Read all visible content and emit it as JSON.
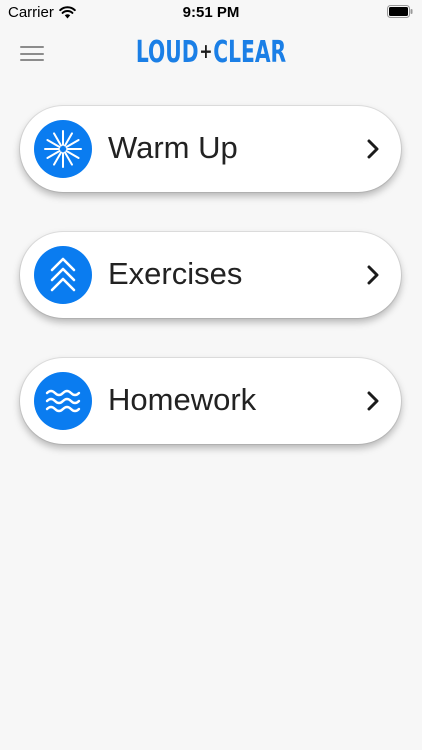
{
  "status_bar": {
    "carrier": "Carrier",
    "time": "9:51 PM"
  },
  "header": {
    "logo_left": "LOUD",
    "logo_plus": "+",
    "logo_right": "CLEAR"
  },
  "menu": [
    {
      "label": "Warm Up",
      "icon": "sunburst-icon"
    },
    {
      "label": "Exercises",
      "icon": "chevrons-up-icon"
    },
    {
      "label": "Homework",
      "icon": "waves-icon"
    }
  ],
  "colors": {
    "accent": "#0a7cf0",
    "logo": "#1b7fe6",
    "background": "#f7f7f7"
  }
}
